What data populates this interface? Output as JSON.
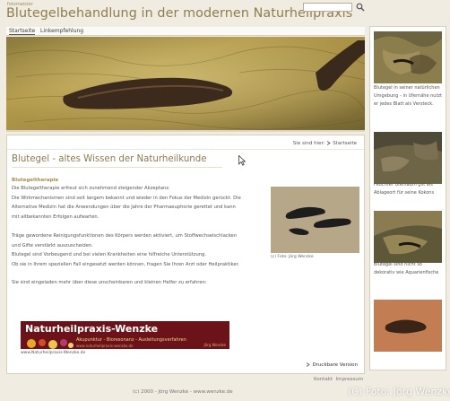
{
  "header": {
    "brand_small": "fotomeister",
    "title": "Blutegelbehandlung in der modernen Naturheilpraxis",
    "search": {
      "value": "",
      "placeholder": ""
    }
  },
  "nav": {
    "items": [
      {
        "label": "Startseite",
        "active": true
      },
      {
        "label": "Linkempfehlung",
        "active": false
      }
    ]
  },
  "breadcrumb": {
    "label": "Sie sind hier:",
    "item": "Startseite"
  },
  "article": {
    "heading": "Blutegel - altes Wissen der Naturheilkunde",
    "subheading": "Blutegeltherapie",
    "p1_lines": [
      "Die Blutegeltherapie erfreut sich zunehmend steigender Akzeptanz.",
      "Die Wirkmechanismen sind seit langem bekannt und wieder in den Fokus der Medizin gerückt. Die",
      "Alternative Medizin hat die Anwendungen über die Jahre der Pharmaeuphorie gerettet und kann",
      "mit altbekannten Erfolgen aufwarten."
    ],
    "p2_lines": [
      "Träge gewordene Reinigungsfunktionen des Körpers werden aktiviert, um Stoffwechselschlacken",
      "und Gifte verstärkt auszuscheiden.",
      "Blutegel sind Vorbeugend und bei vielen Krankheiten eine hilfreiche Unterstützung.",
      "Ob sie in Ihrem speziellen Fall eingesetzt werden können, fragen Sie Ihren Arzt oder Heilpraktiker."
    ],
    "p3": "Sie sind eingeladen mehr über diese unscheinbaren und kleinen Helfer zu erfahren:",
    "photo_caption": "(c) Foto: Jörg Wenzke"
  },
  "banner": {
    "title": "Naturheilpraxis-Wenzke",
    "subtitle": "Akupunktur - Bioresonanz - Ausleitungsverfahren",
    "url_inside": "www.naturheilpraxis-wenzke.de",
    "credit": "Jörg Wenzke",
    "caption": "www.Naturheilpraxis-Wenzke.de"
  },
  "print_label": "Druckbare Version",
  "footer": {
    "kontakt": "Kontakt",
    "impressum": "Impressum",
    "copyright": "(c) 2000 - Jörg Wenzke - www.wenzke.de"
  },
  "watermark": "(C) Foto: Jörg Wenzke",
  "sidebar": {
    "items": [
      {
        "text": "Blutegel in seiner natürlichen Umgebung - in Ufernähe nutzt er jedes Blatt als Versteck."
      },
      {
        "text": "Feuchter Ufersaum gilt als Ablageort für seine Kokons"
      },
      {
        "text": "Blutegel sind nicht so dekorativ wie Aquarienfische"
      },
      {
        "text": ""
      }
    ]
  },
  "colors": {
    "title": "#8e7d4e",
    "accent": "#a88c4a",
    "banner": "#6b1318",
    "background": "#f1ece2"
  },
  "icons": {
    "search": "search-icon",
    "arrow": "arrow-right-icon",
    "cursor": "mouse-cursor-icon"
  }
}
